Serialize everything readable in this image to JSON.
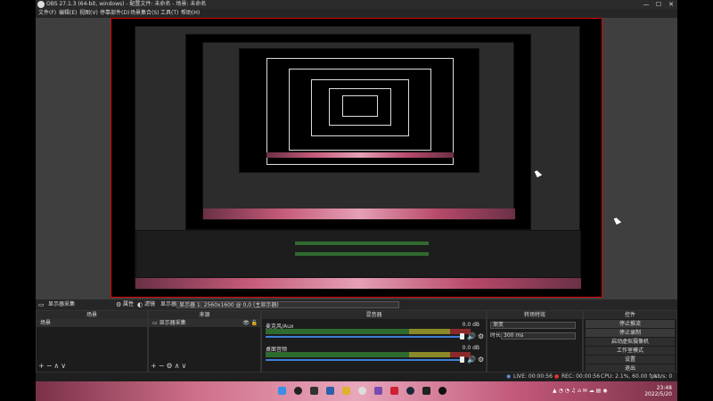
{
  "window": {
    "title": "OBS 27.1.3 (64-bit, windows) - 配置文件: 未命名 - 场景: 未命名",
    "min": "—",
    "max": "☐",
    "close": "✕"
  },
  "menu": [
    "文件(F)",
    "编辑(E)",
    "视图(V)",
    "停靠部件(D)",
    "场景集合(S)",
    "工具(T)",
    "帮助(H)"
  ],
  "source_bar": {
    "scene_label": "显示器采集",
    "properties": "属性",
    "filters": "滤镜",
    "display_label": "显示器",
    "display_value": "显示器 1: 2560x1600 @ 0,0 (主显示器)"
  },
  "docks": {
    "scenes": {
      "title": "场景",
      "items": [
        "场景"
      ]
    },
    "sources": {
      "title": "来源",
      "items": [
        "显示器采集"
      ]
    },
    "mixer": {
      "title": "混音器",
      "channels": [
        {
          "name": "麦克风/Aux",
          "db": "0.0 dB"
        },
        {
          "name": "桌面音频",
          "db": "0.0 dB"
        }
      ]
    },
    "transitions": {
      "title": "转场特效",
      "type": "渐变",
      "duration_label": "时长",
      "duration_value": "300 ms"
    },
    "controls": {
      "title": "控件",
      "buttons": [
        "停止推流",
        "停止录制",
        "启动虚拟摄像机",
        "工作室模式",
        "设置",
        "退出"
      ]
    }
  },
  "status": {
    "live": "LIVE: 00:00:56",
    "rec": "REC: 00:00:56",
    "cpu": "CPU: 2.1%, 60.00 fps",
    "kbps": "kb/s: 0"
  },
  "taskbar": {
    "time": "23:48",
    "date": "2022/5/20"
  },
  "colors": {
    "recording_border": "#dd0000",
    "accent_volume": "#3d7fd6"
  }
}
